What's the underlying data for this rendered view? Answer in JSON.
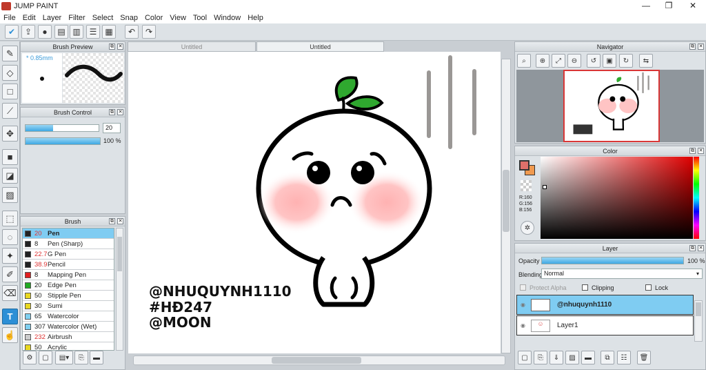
{
  "app": {
    "title": "JUMP PAINT"
  },
  "window_controls": {
    "minimize": "—",
    "maximize": "❐",
    "close": "✕"
  },
  "menu": [
    "File",
    "Edit",
    "Layer",
    "Filter",
    "Select",
    "Snap",
    "Color",
    "View",
    "Tool",
    "Window",
    "Help"
  ],
  "tabs": [
    {
      "label": "Untitled",
      "active": false
    },
    {
      "label": "Untitled",
      "active": true
    }
  ],
  "brush_preview": {
    "title": "Brush Preview",
    "size": "* 0.85mm"
  },
  "brush_control": {
    "title": "Brush Control",
    "size_value": "20",
    "opacity_value": "100 %",
    "size_fraction": 0.38,
    "opacity_fraction": 1.0
  },
  "brush_panel": {
    "title": "Brush",
    "items": [
      {
        "size": "20",
        "name": "Pen",
        "color": "#222222",
        "red": true,
        "selected": true
      },
      {
        "size": "8",
        "name": "Pen (Sharp)",
        "color": "#222222",
        "red": false,
        "selected": false
      },
      {
        "size": "22.7",
        "name": "G Pen",
        "color": "#222222",
        "red": true,
        "selected": false
      },
      {
        "size": "38.9",
        "name": "Pencil",
        "color": "#222222",
        "red": true,
        "selected": false
      },
      {
        "size": "8",
        "name": "Mapping Pen",
        "color": "#e02020",
        "red": false,
        "selected": false
      },
      {
        "size": "20",
        "name": "Edge Pen",
        "color": "#22aa22",
        "red": false,
        "selected": false
      },
      {
        "size": "50",
        "name": "Stipple Pen",
        "color": "#e8d820",
        "red": false,
        "selected": false
      },
      {
        "size": "30",
        "name": "Sumi",
        "color": "#e8d820",
        "red": false,
        "selected": false
      },
      {
        "size": "65",
        "name": "Watercolor",
        "color": "#7fd0f0",
        "red": false,
        "selected": false
      },
      {
        "size": "307",
        "name": "Watercolor (Wet)",
        "color": "#7fd0f0",
        "red": false,
        "selected": false
      },
      {
        "size": "232",
        "name": "Airbrush",
        "color": "#cccccc",
        "red": true,
        "selected": false
      },
      {
        "size": "50",
        "name": "Acrylic",
        "color": "#e8d820",
        "red": false,
        "selected": false
      }
    ]
  },
  "navigator": {
    "title": "Navigator"
  },
  "color_panel": {
    "title": "Color",
    "r": "R:160",
    "g": "G:156",
    "b": "B:156",
    "fg": "#e0706a",
    "bg": "#f09a50"
  },
  "layer_panel": {
    "title": "Layer",
    "opacity_label": "Opacity",
    "opacity_value": "100 %",
    "opacity_fraction": 1.0,
    "blending_label": "Blending",
    "blending_value": "Normal",
    "protect_alpha": "Protect Alpha",
    "clipping": "Clipping",
    "lock": "Lock",
    "layers": [
      {
        "name": "@nhuquynh1110",
        "selected": true
      },
      {
        "name": "Layer1",
        "selected": false
      }
    ]
  },
  "artwork": {
    "text": [
      "@NHUQUYNH1110",
      "#HĐ247",
      "@MOON"
    ]
  },
  "icons": {
    "toolbar": [
      "check-icon",
      "export-icon",
      "comment-icon",
      "chat-icon",
      "document-icon",
      "list-icon",
      "grid-icon",
      "undo-icon",
      "redo-icon"
    ],
    "tools": [
      "brush-icon",
      "eraser-icon",
      "rectangle-icon",
      "line-icon",
      "move-icon",
      "fill-rect-icon",
      "bucket-icon",
      "gradient-icon",
      "marquee-icon",
      "lasso-icon",
      "magic-wand-icon",
      "select-pen-icon",
      "select-eraser-icon",
      "text-icon",
      "hand-icon"
    ]
  }
}
